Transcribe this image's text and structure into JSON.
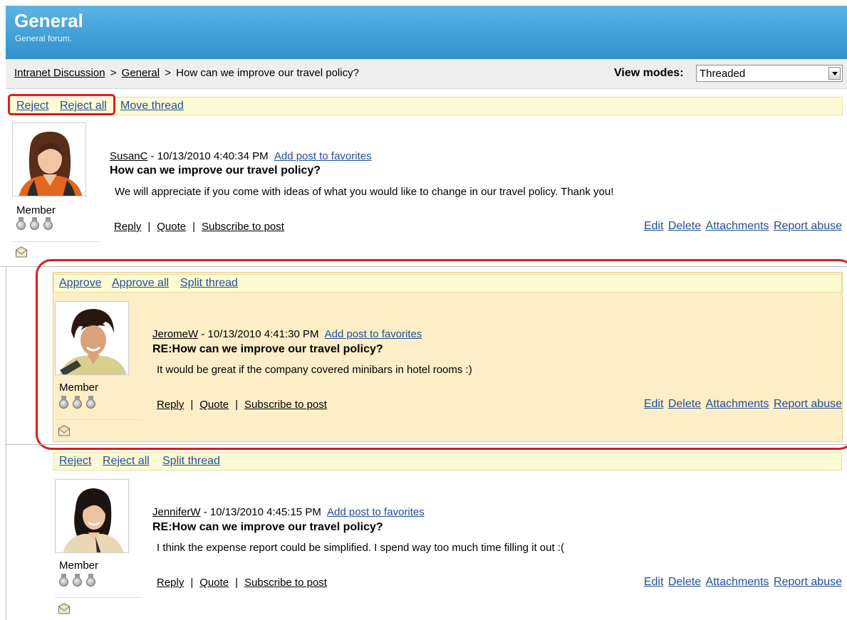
{
  "header": {
    "title": "General",
    "subtitle": "General forum."
  },
  "breadcrumb": {
    "root": "Intranet Discussion",
    "sep1": ">",
    "forum": "General",
    "sep2": ">",
    "current": "How can we improve our travel policy?"
  },
  "view_modes": {
    "label": "View modes:",
    "selected": "Threaded"
  },
  "thread_actions": {
    "reject": "Reject",
    "reject_all": "Reject all",
    "move_thread": "Move thread"
  },
  "posts": [
    {
      "author": "SusanC",
      "meta": " - 10/13/2010 4:40:34 PM",
      "add_fav": "Add post to favorites",
      "title": "How can we improve our travel policy?",
      "text": "We will appreciate if you come with ideas of what you would like to change in our travel policy. Thank you!",
      "rank": "Member",
      "mod": null
    },
    {
      "author": "JeromeW",
      "meta": " - 10/13/2010 4:41:30 PM",
      "add_fav": "Add post to favorites",
      "title": "RE:How can we improve our travel policy?",
      "text": "It would be great if the company covered minibars in hotel rooms :)",
      "rank": "Member",
      "mod": {
        "a": "Approve",
        "b": "Approve all",
        "c": "Split thread"
      }
    },
    {
      "author": "JenniferW",
      "meta": " - 10/13/2010 4:45:15 PM",
      "add_fav": "Add post to favorites",
      "title": "RE:How can we improve our travel policy?",
      "text": "I think the expense report could be simplified. I spend way too much time filling it out :(",
      "rank": "Member",
      "mod": {
        "a": "Reject",
        "b": "Reject all",
        "c": "Split thread"
      }
    }
  ],
  "post_actions": {
    "reply": "Reply",
    "quote": "Quote",
    "subscribe": "Subscribe to post",
    "bar": "|"
  },
  "post_admin": {
    "edit": "Edit",
    "delete": "Delete",
    "attachments": "Attachments",
    "report": "Report abuse"
  },
  "colors": {
    "header_blue": "#3f9fd7",
    "link": "#1f4e9c",
    "mod_bar": "#fdfbd3",
    "highlight": "#fdeec7",
    "annotation_red": "#dc1e1e"
  }
}
